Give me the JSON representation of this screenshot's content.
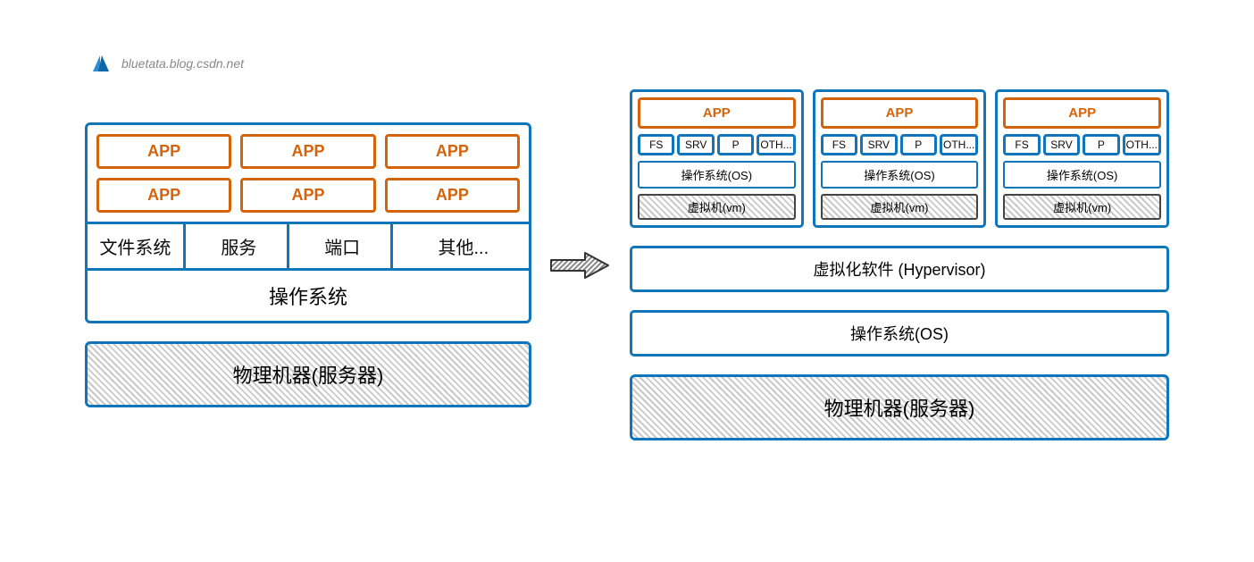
{
  "watermark": "bluetata.blog.csdn.net",
  "left": {
    "apps": [
      "APP",
      "APP",
      "APP",
      "APP",
      "APP",
      "APP"
    ],
    "sys": {
      "fs": "文件系统",
      "srv": "服务",
      "port": "端口",
      "other": "其他..."
    },
    "os": "操作系统",
    "physical": "物理机器(服务器)"
  },
  "right": {
    "vm": {
      "app": "APP",
      "sys": {
        "fs": "FS",
        "srv": "SRV",
        "p": "P",
        "oth": "OTH..."
      },
      "os": "操作系统(OS)",
      "vm_label": "虚拟机(vm)"
    },
    "hypervisor": "虚拟化软件  (Hypervisor)",
    "os": "操作系统(OS)",
    "physical": "物理机器(服务器)"
  }
}
